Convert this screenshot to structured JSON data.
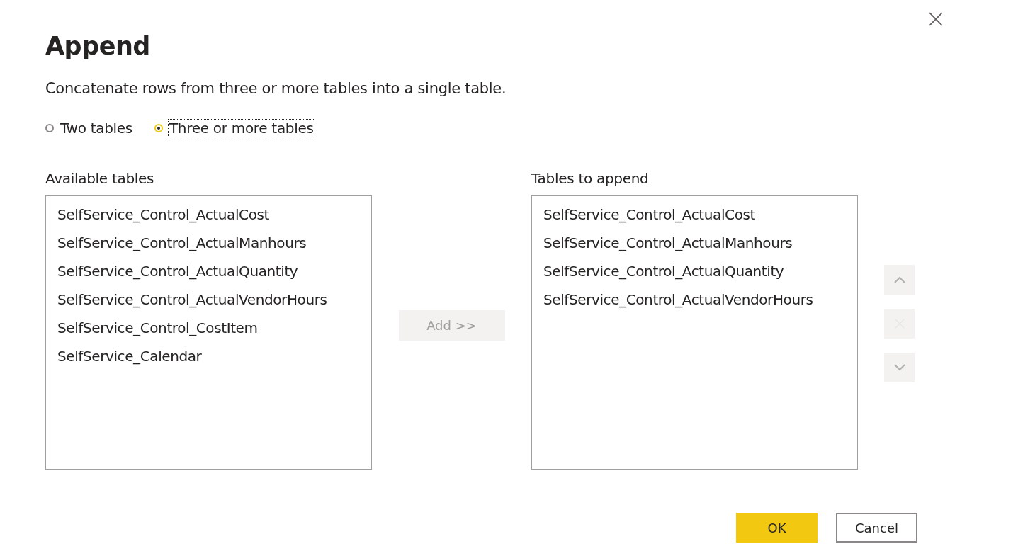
{
  "dialog": {
    "title": "Append",
    "description": "Concatenate rows from three or more tables into a single table."
  },
  "modes": [
    {
      "label": "Two tables",
      "selected": false
    },
    {
      "label": "Three or more tables",
      "selected": true
    }
  ],
  "available": {
    "label": "Available tables",
    "items": [
      "SelfService_Control_ActualCost",
      "SelfService_Control_ActualManhours",
      "SelfService_Control_ActualQuantity",
      "SelfService_Control_ActualVendorHours",
      "SelfService_Control_CostItem",
      "SelfService_Calendar"
    ]
  },
  "add_button": {
    "label": "Add >>",
    "disabled": true
  },
  "to_append": {
    "label": "Tables to append",
    "items": [
      "SelfService_Control_ActualCost",
      "SelfService_Control_ActualManhours",
      "SelfService_Control_ActualQuantity",
      "SelfService_Control_ActualVendorHours"
    ]
  },
  "order_buttons": [
    {
      "kind": "up",
      "disabled": true
    },
    {
      "kind": "remove",
      "disabled": true
    },
    {
      "kind": "down",
      "disabled": true
    }
  ],
  "buttons": [
    {
      "kind": "primary",
      "label": "OK"
    },
    {
      "kind": "secondary",
      "label": "Cancel"
    }
  ]
}
